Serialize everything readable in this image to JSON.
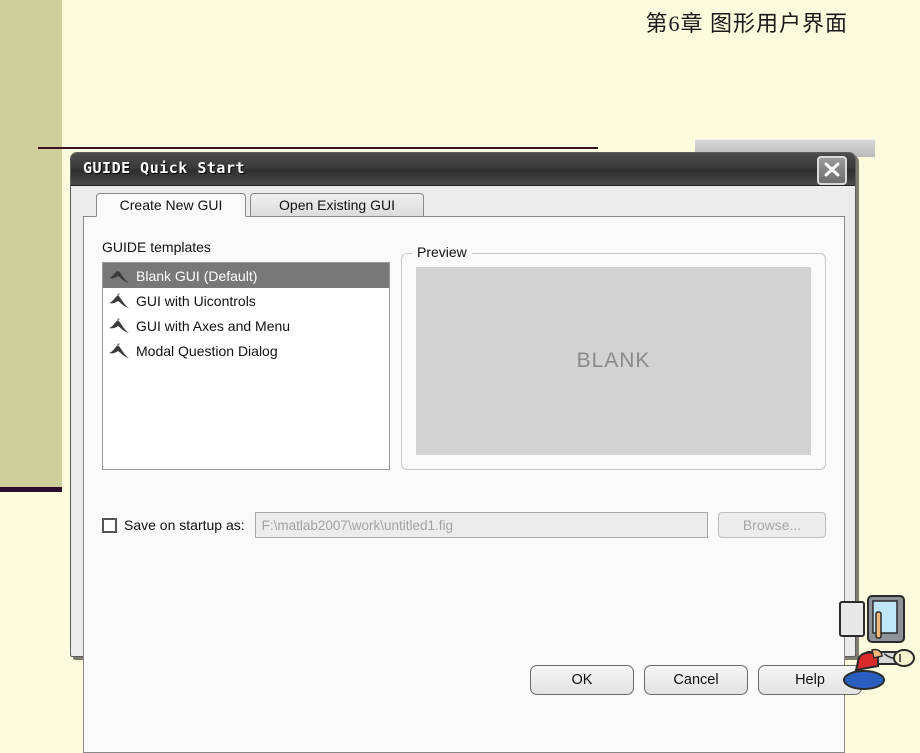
{
  "slide": {
    "header_text": "第6章 图形用户界面",
    "background_color": "#fdfbdd",
    "sidebar_color": "#cfcf9c",
    "rule_color": "#3b1220"
  },
  "dialog": {
    "title": "GUIDE Quick Start",
    "close_icon": "close-icon",
    "tabs": [
      {
        "label": "Create New GUI",
        "active": true
      },
      {
        "label": "Open Existing GUI",
        "active": false
      }
    ],
    "templates_label": "GUIDE templates",
    "templates": [
      {
        "label": "Blank GUI (Default)",
        "icon": "matlab-membrane-icon",
        "selected": true
      },
      {
        "label": "GUI with Uicontrols",
        "icon": "matlab-membrane-icon",
        "selected": false
      },
      {
        "label": "GUI with Axes and Menu",
        "icon": "matlab-membrane-icon",
        "selected": false
      },
      {
        "label": "Modal Question Dialog",
        "icon": "matlab-membrane-icon",
        "selected": false
      }
    ],
    "preview": {
      "legend": "Preview",
      "content_text": "BLANK",
      "canvas_color": "#d2d2d2"
    },
    "save_row": {
      "checkbox_checked": false,
      "label": "Save on startup as:",
      "path_value": "F:\\matlab2007\\work\\untitled1.fig",
      "browse_label": "Browse...",
      "enabled": false
    },
    "buttons": {
      "ok": "OK",
      "cancel": "Cancel",
      "help": "Help"
    },
    "selection_color": "#787878"
  }
}
